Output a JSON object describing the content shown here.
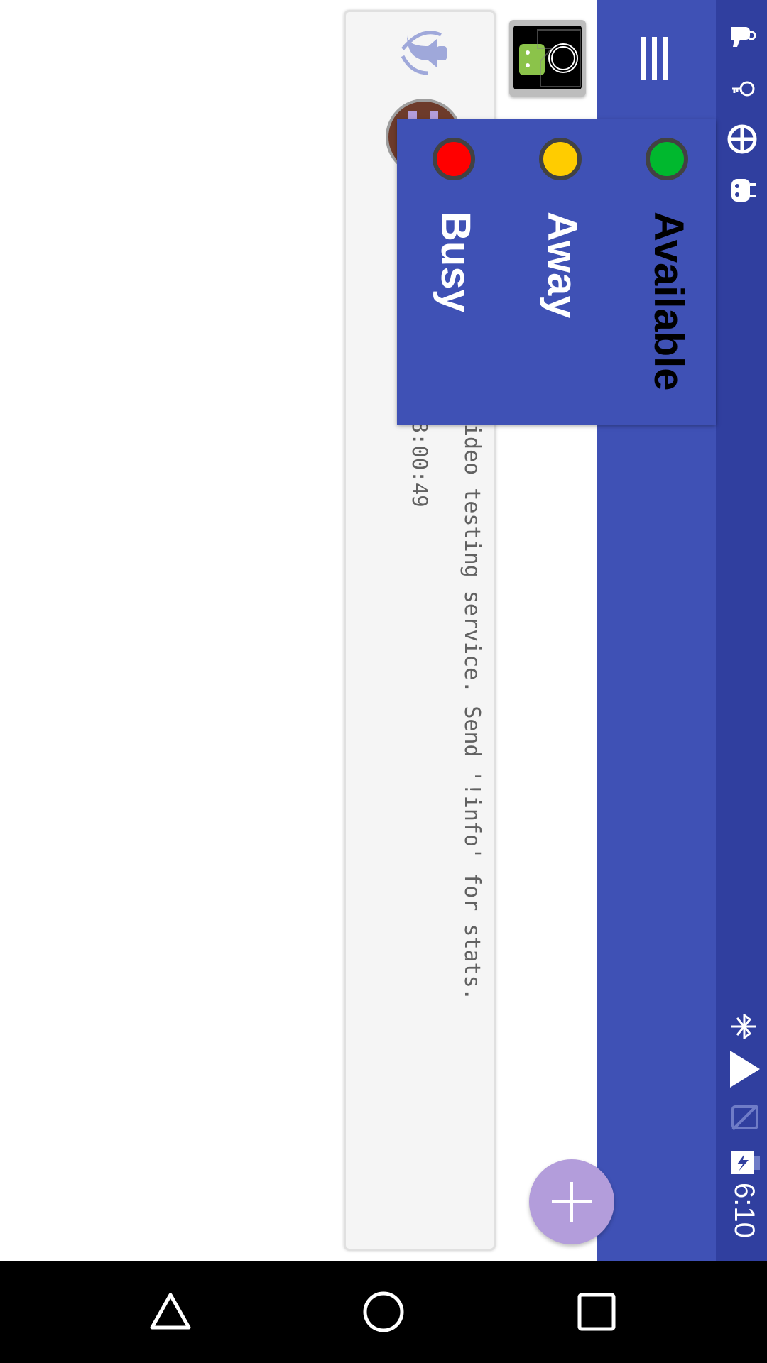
{
  "status_bar": {
    "time": "6:10",
    "icons": [
      "hand-icon",
      "key-icon",
      "sync-icon",
      "android-icon",
      "bluetooth-icon",
      "wifi-icon",
      "no-sim-icon",
      "battery-charging-icon"
    ]
  },
  "toolbar": {
    "app_icon": "android-keyring-icon",
    "menu_icon": "hamburger-menu-icon"
  },
  "message": {
    "text": "ideo testing service. Send '!info' for stats.",
    "timestamp": "2018-02-19 18:00:49",
    "bell_icon": "bell-icon",
    "avatar": "avatar"
  },
  "status_menu": {
    "items": [
      {
        "label": "Available",
        "color": "#00b82e",
        "text_color": "#000000"
      },
      {
        "label": "Away",
        "color": "#ffcc00",
        "text_color": "#ffffff"
      },
      {
        "label": "Busy",
        "color": "#ff0000",
        "text_color": "#ffffff"
      }
    ]
  },
  "fab": {
    "icon": "plus-icon"
  },
  "nav_bar": {
    "buttons": [
      "back-icon",
      "home-icon",
      "recents-icon"
    ]
  },
  "colors": {
    "primary": "#3f51b5",
    "primary_dark": "#303f9f",
    "accent": "#b39ddb",
    "card": "#f5f5f5"
  }
}
